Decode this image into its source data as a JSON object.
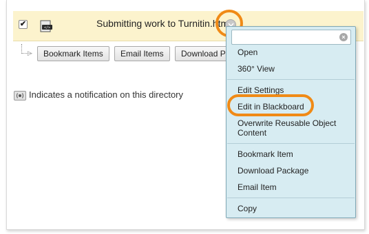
{
  "item": {
    "title": "Submitting work to Turnitin.html",
    "checkbox_mark": "✔",
    "file_icon": "html-file-icon"
  },
  "actions": {
    "bookmark": "Bookmark Items",
    "email": "Email Items",
    "download": "Download P"
  },
  "notification": {
    "text": "Indicates a notification on this directory"
  },
  "menu": {
    "close_glyph": "×",
    "items": [
      "Open",
      "360° View",
      "Edit Settings",
      "Edit in Blackboard",
      "Overwrite Reusable Object",
      "Content",
      "Bookmark Item",
      "Download Package",
      "Email Item",
      "Copy"
    ]
  },
  "colors": {
    "highlight_row": "#fcf3cd",
    "menu_bg": "#d7ecf2",
    "callout": "#f08a16"
  }
}
